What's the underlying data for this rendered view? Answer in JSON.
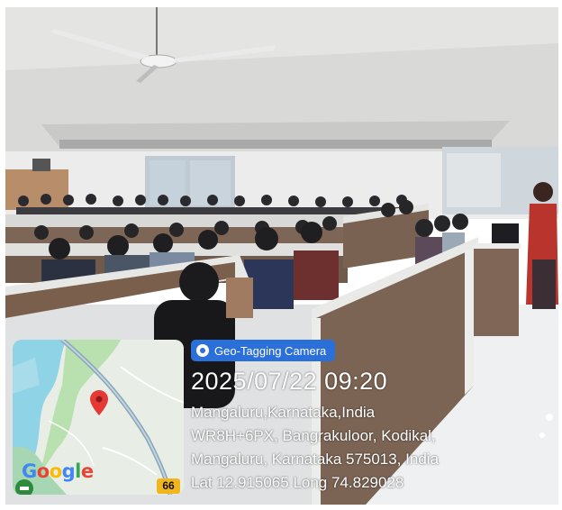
{
  "overlay": {
    "app_name": "Geo-Tagging Camera",
    "datetime": "2025/07/22 09:20",
    "address_lines": [
      "Mangaluru,Karnataka,India",
      "WR8H+6PX, Bangrakuloor, Kodikal,",
      "Mangaluru, Karnataka 575013, India",
      "Lat 12.915065 Long 74.829028"
    ]
  },
  "map": {
    "brand": "Google",
    "route_number": "66",
    "pin_icon": "map-pin-icon"
  },
  "photo": {
    "description_icon": "classroom-photo",
    "ceiling_color": "#dcdcdb",
    "wall_color": "#ececec"
  }
}
